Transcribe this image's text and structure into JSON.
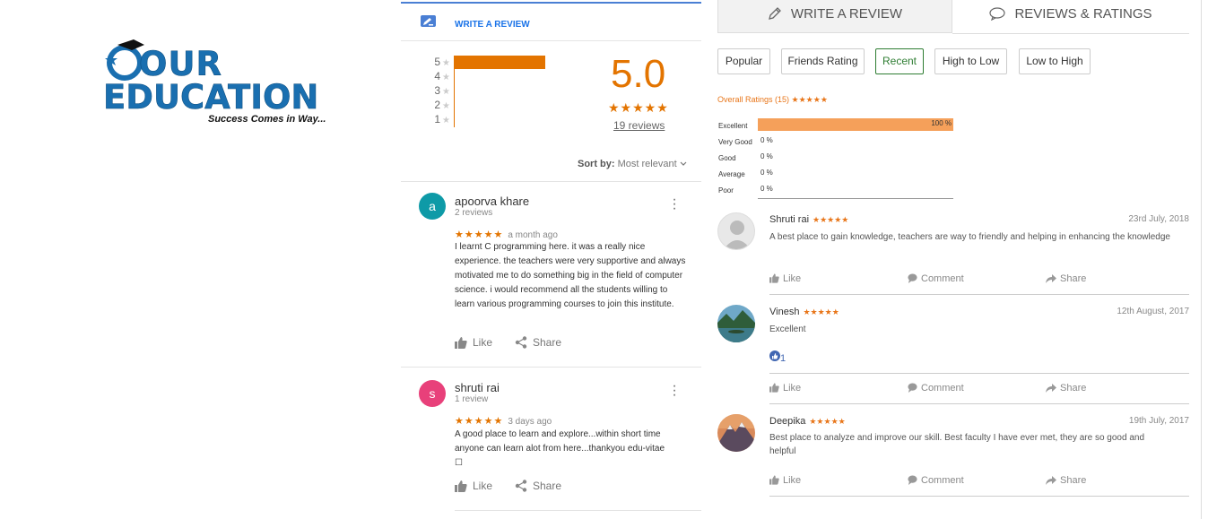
{
  "logo": {
    "line1": "OUR",
    "line2": "EDUCATION",
    "tagline": "Success Comes in Way..."
  },
  "google": {
    "write_review": "WRITE A REVIEW",
    "rating_rows": [
      {
        "label": "5",
        "fraction": 1.0
      },
      {
        "label": "4",
        "fraction": 0
      },
      {
        "label": "3",
        "fraction": 0
      },
      {
        "label": "2",
        "fraction": 0
      },
      {
        "label": "1",
        "fraction": 0
      }
    ],
    "score": "5.0",
    "score_stars": "★★★★★",
    "review_count": "19 reviews",
    "sort_label": "Sort by:",
    "sort_value": "Most relevant",
    "reviews": [
      {
        "initial": "a",
        "avatar_color": "#0e9aa7",
        "name": "apoorva khare",
        "sub": "2 reviews",
        "stars": "★★★★★",
        "ago": "a month ago",
        "text": "I learnt C programming here. it was a really nice experience. the teachers were very supportive and always motivated me to do  something big in the field of computer science. i would recommend all the students willing to learn various programming courses to join this institute.",
        "like": "Like",
        "share": "Share"
      },
      {
        "initial": "s",
        "avatar_color": "#e8407a",
        "name": "shruti rai",
        "sub": "1 review",
        "stars": "★★★★★",
        "ago": "3 days ago",
        "text": "A good place to learn and explore...within short time anyone can learn alot from here...thankyou edu-vitae",
        "text_extra": "☐",
        "like": "Like",
        "share": "Share"
      }
    ]
  },
  "right": {
    "tabs": [
      "WRITE A REVIEW",
      "REVIEWS & RATINGS"
    ],
    "filters": [
      "Popular",
      "Friends Rating",
      "Recent",
      "High to Low",
      "Low to High"
    ],
    "active_filter": "Recent",
    "overall_label": "Overall Ratings (15)",
    "overall_stars": "★★★★★",
    "breakdown": [
      {
        "label": "Excellent",
        "pct": "100 %"
      },
      {
        "label": "Very Good",
        "pct": "0 %"
      },
      {
        "label": "Good",
        "pct": "0 %"
      },
      {
        "label": "Average",
        "pct": "0 %"
      },
      {
        "label": "Poor",
        "pct": "0 %"
      }
    ],
    "reviews": [
      {
        "name": "Shruti rai",
        "stars": "★★★★★",
        "date": "23rd July, 2018",
        "text": "A best place to gain knowledge, teachers are way to friendly and helping in enhancing the knowledge",
        "like": "Like",
        "comment": "Comment",
        "share": "Share"
      },
      {
        "name": "Vinesh",
        "stars": "★★★★★",
        "date": "12th August, 2017",
        "text": "Excellent",
        "likes_count": "1",
        "like": "Like",
        "comment": "Comment",
        "share": "Share"
      },
      {
        "name": "Deepika",
        "stars": "★★★★★",
        "date": "19th July, 2017",
        "text": "Best place to analyze and improve our skill. Best faculty I have ever met, they are so good and helpful",
        "like": "Like",
        "comment": "Comment",
        "share": "Share"
      }
    ]
  }
}
